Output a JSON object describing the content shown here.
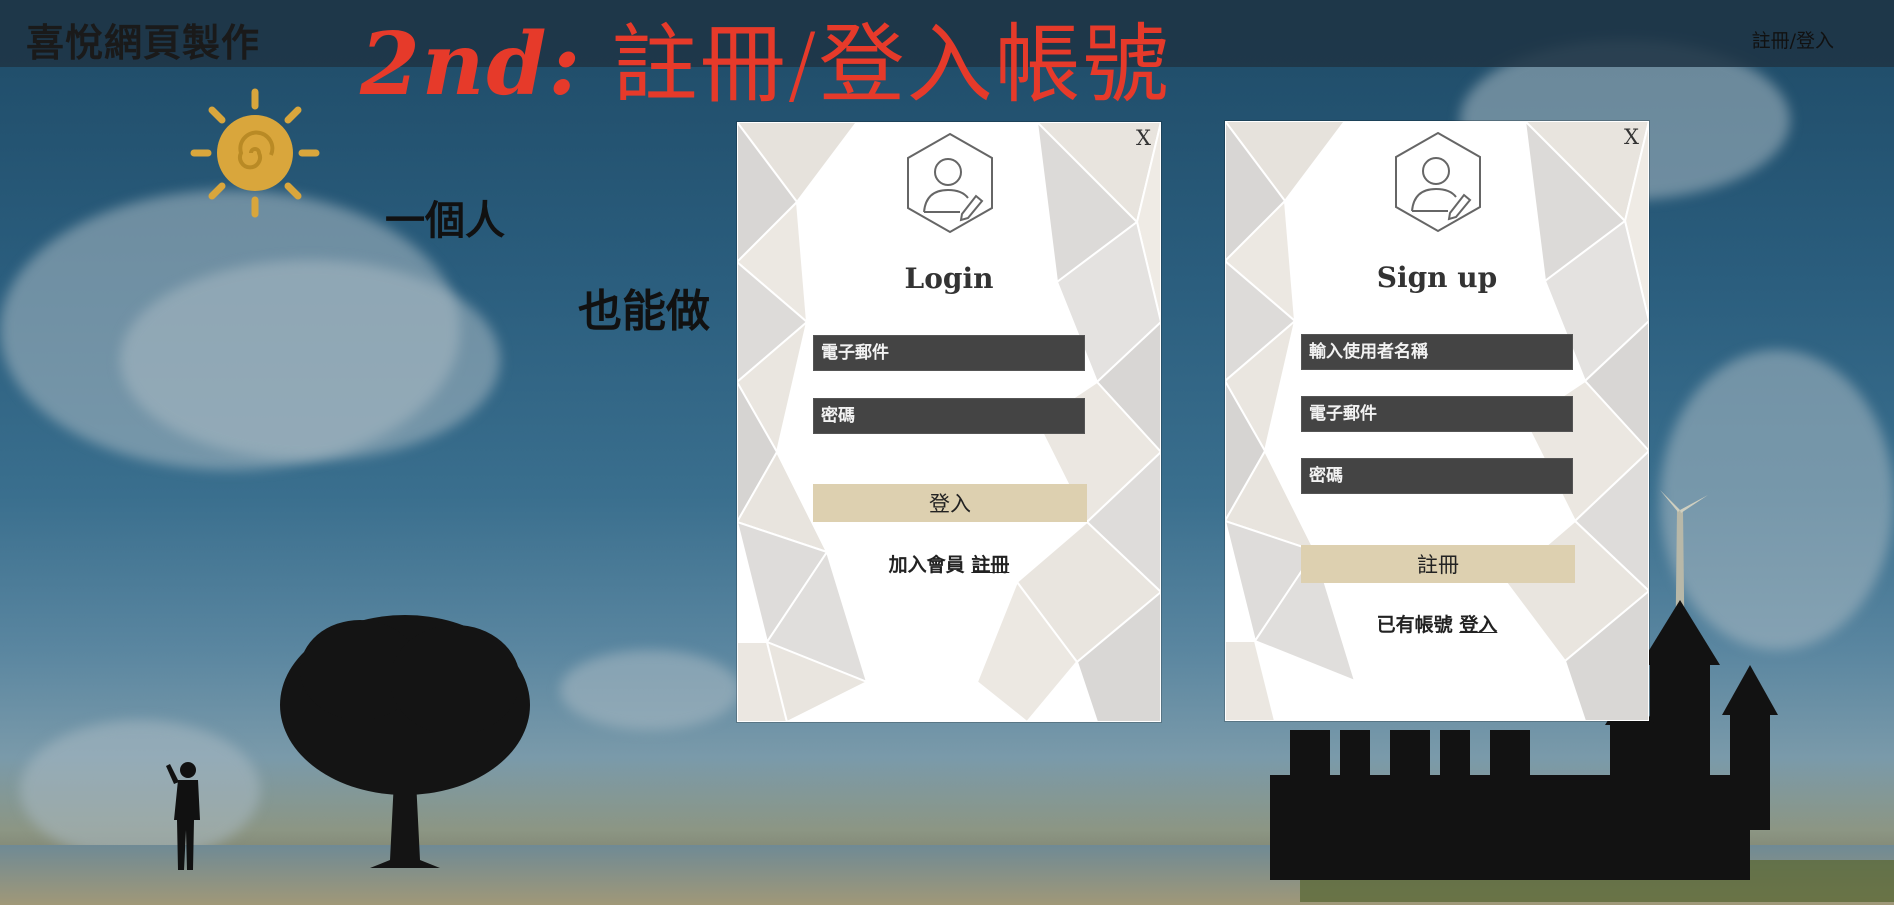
{
  "header": {
    "brand": "喜悅網頁製作",
    "headline_num": "2nd:",
    "headline_text": "註冊/登入帳號",
    "nav_link": "註冊/登入"
  },
  "background": {
    "handwriting_1": "一個人",
    "handwriting_2": "也能做"
  },
  "login": {
    "close": "X",
    "title": "Login",
    "email_placeholder": "電子郵件",
    "password_placeholder": "密碼",
    "submit": "登入",
    "switch_text": "加入會員",
    "switch_link": "註冊"
  },
  "signup": {
    "close": "X",
    "title": "Sign up",
    "username_placeholder": "輸入使用者名稱",
    "email_placeholder": "電子郵件",
    "password_placeholder": "密碼",
    "submit": "註冊",
    "switch_text": "已有帳號",
    "switch_link": "登入"
  },
  "colors": {
    "headline": "#e63a2a",
    "field_bg": "#444444",
    "button_bg": "#ddd0b0",
    "sun": "#d9a63c"
  }
}
